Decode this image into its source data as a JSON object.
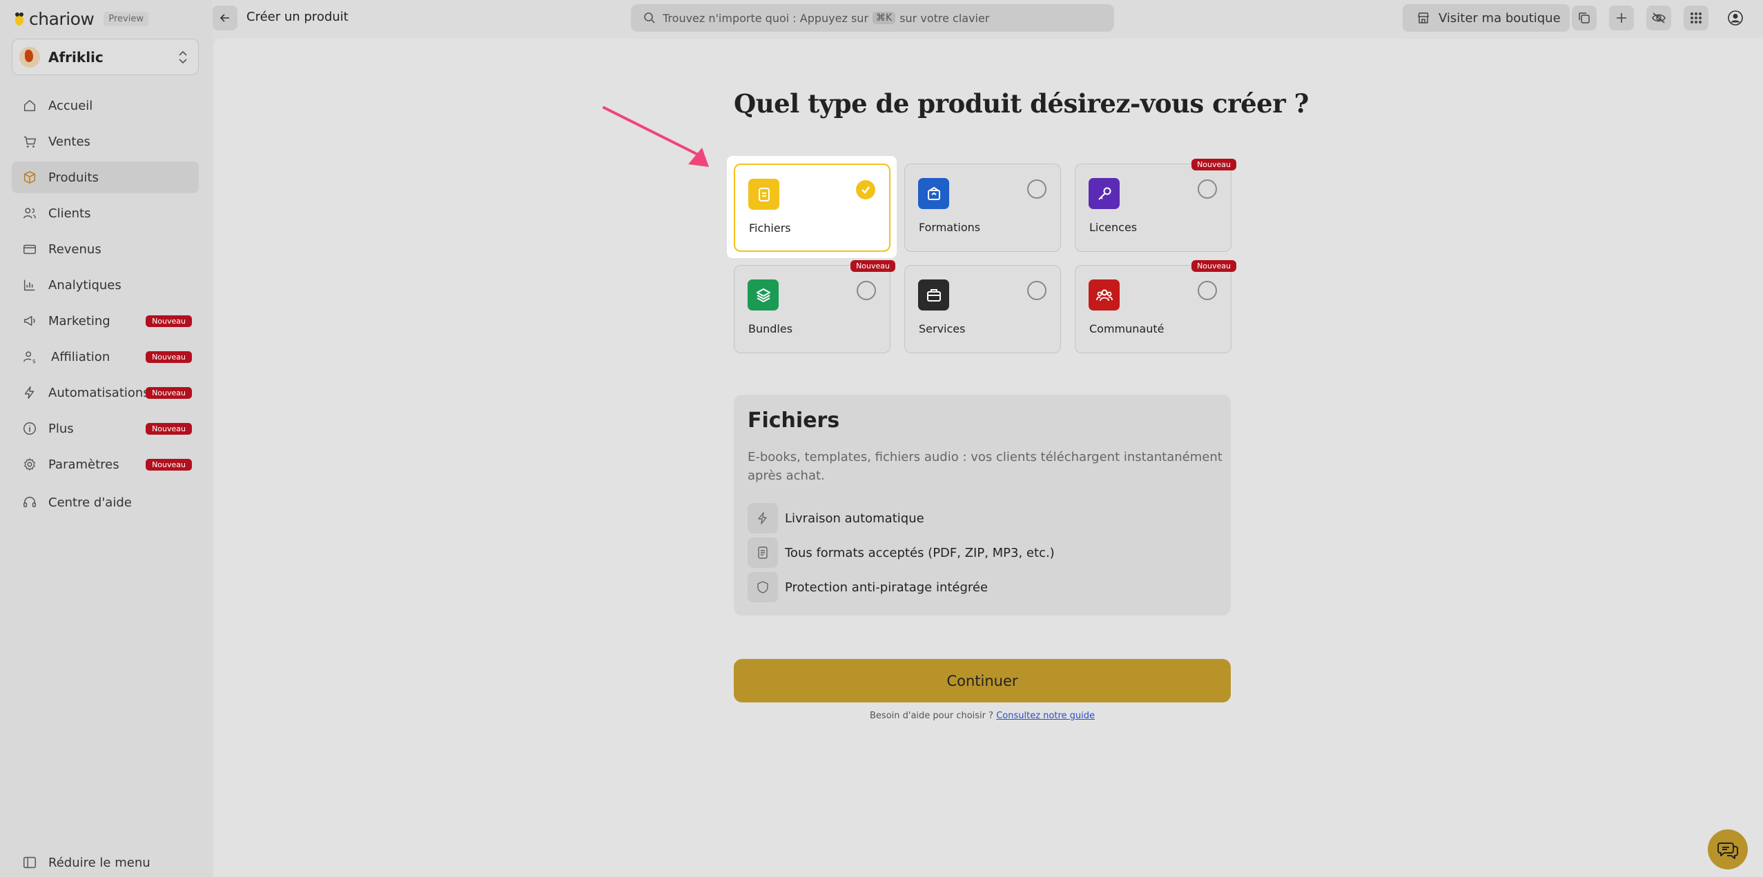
{
  "app": {
    "logo_text": "chariow",
    "preview_label": "Preview",
    "store_name": "Afriklic"
  },
  "sidebar": {
    "items": [
      {
        "label": "Accueil",
        "icon": "home-icon"
      },
      {
        "label": "Ventes",
        "icon": "cart-icon"
      },
      {
        "label": "Produits",
        "icon": "box-icon",
        "active": true
      },
      {
        "label": "Clients",
        "icon": "users-icon"
      },
      {
        "label": "Revenus",
        "icon": "money-icon"
      },
      {
        "label": "Analytiques",
        "icon": "chart-icon"
      },
      {
        "label": "Marketing",
        "icon": "megaphone-icon",
        "badge": "Nouveau"
      },
      {
        "label": "Affiliation",
        "icon": "affiliate-icon",
        "badge": "Nouveau"
      },
      {
        "label": "Automatisations",
        "icon": "bolt-icon",
        "badge": "Nouveau"
      },
      {
        "label": "Plus",
        "icon": "info-icon",
        "badge": "Nouveau"
      },
      {
        "label": "Paramètres",
        "icon": "gear-icon",
        "badge": "Nouveau"
      }
    ],
    "help_label": "Centre d'aide",
    "collapse_label": "Réduire le menu"
  },
  "topbar": {
    "page_title": "Créer un produit",
    "search_text_before": "Trouvez n'importe quoi : Appuyez sur",
    "search_kbd": "⌘K",
    "search_text_after": "sur votre clavier",
    "visit_label": "Visiter ma boutique"
  },
  "main": {
    "question": "Quel type de produit désirez-vous créer ?",
    "cards": [
      {
        "label": "Fichiers",
        "icon": "file-icon",
        "color": "#f2c21b",
        "selected": true
      },
      {
        "label": "Formations",
        "icon": "graduation-icon",
        "color": "#1f5fc8"
      },
      {
        "label": "Licences",
        "icon": "key-icon",
        "color": "#5b2bb5",
        "badge": "Nouveau"
      },
      {
        "label": "Bundles",
        "icon": "layers-icon",
        "color": "#1b9a54",
        "badge": "Nouveau"
      },
      {
        "label": "Services",
        "icon": "briefcase-icon",
        "color": "#2a2a2a"
      },
      {
        "label": "Communauté",
        "icon": "community-icon",
        "color": "#c41a1a",
        "badge": "Nouveau"
      }
    ],
    "info": {
      "title": "Fichiers",
      "description": "E-books, templates, fichiers audio : vos clients téléchargent instantanément après achat.",
      "features": [
        {
          "label": "Livraison automatique",
          "icon": "bolt-icon"
        },
        {
          "label": "Tous formats acceptés (PDF, ZIP, MP3, etc.)",
          "icon": "document-icon"
        },
        {
          "label": "Protection anti-piratage intégrée",
          "icon": "shield-icon"
        }
      ]
    },
    "continue_label": "Continuer",
    "help_text": "Besoin d'aide pour choisir ?",
    "help_link": "Consultez notre guide"
  },
  "colors": {
    "accent": "#f2c21b",
    "button": "#b8932a",
    "badge": "#b2101d",
    "arrow": "#f0457a"
  }
}
